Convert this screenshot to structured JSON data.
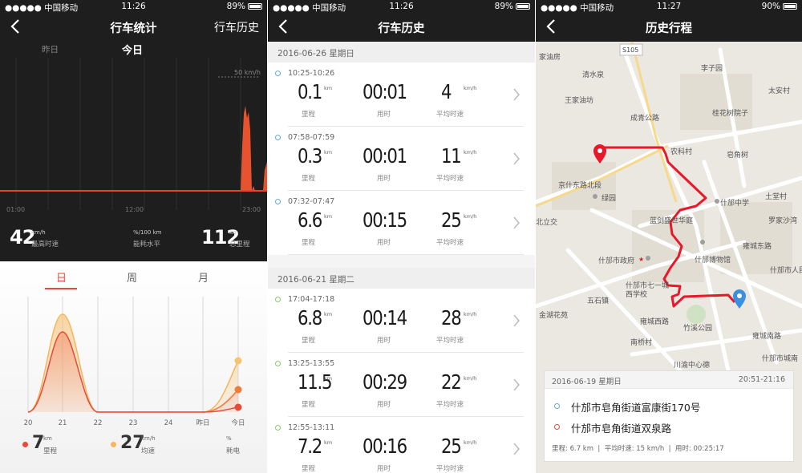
{
  "screens": [
    {
      "status": {
        "carrier": "●●●●● 中国移动",
        "wifi": "wifi-icon",
        "time": "11:26",
        "battery": "89%"
      },
      "nav": {
        "title": "行车统计",
        "right": "行车历史"
      },
      "day_tabs": {
        "yesterday": "昨日",
        "today": "今日"
      },
      "speed_chart": {
        "limit_label": "50 km/h",
        "x_ticks": [
          "01:00",
          "12:00",
          "23:00"
        ]
      },
      "stats": [
        {
          "value": "42",
          "unit": "km/h",
          "label": "最高时速"
        },
        {
          "value": "",
          "unit": "%/100 km",
          "label": "能耗水平"
        },
        {
          "value": "112",
          "unit": "km",
          "label": "总里程"
        }
      ],
      "period_tabs": [
        "日",
        "周",
        "月"
      ],
      "trend_chart": {
        "x_ticks": [
          "20",
          "21",
          "22",
          "23",
          "24",
          "昨日",
          "今日"
        ],
        "colors": {
          "mileage": "#e64a3a",
          "speed": "#f6b65a",
          "battery": "#f07c3b"
        }
      },
      "legend": [
        {
          "value": "7",
          "unit": "km",
          "label": "里程",
          "color": "#e64a3a"
        },
        {
          "value": "27",
          "unit": "km/h",
          "label": "均速",
          "color": "#f6b65a"
        },
        {
          "value": "",
          "unit": "%",
          "label": "耗电",
          "color": ""
        }
      ]
    },
    {
      "status": {
        "carrier": "●●●●● 中国移动",
        "time": "11:26",
        "battery": "89%"
      },
      "nav": {
        "title": "行车历史"
      },
      "groups": [
        {
          "date": "2016-06-26 星期日",
          "trips": [
            {
              "time": "10:25-10:26",
              "distance": "0.1",
              "dist_unit": "km",
              "dist_label": "里程",
              "duration": "00:01",
              "dur_label": "用时",
              "speed": "4",
              "speed_unit": "km/h",
              "speed_label": "平均时速"
            },
            {
              "time": "07:58-07:59",
              "distance": "0.3",
              "dist_unit": "km",
              "dist_label": "里程",
              "duration": "00:01",
              "dur_label": "用时",
              "speed": "11",
              "speed_unit": "km/h",
              "speed_label": "平均时速"
            },
            {
              "time": "07:32-07:47",
              "distance": "6.6",
              "dist_unit": "km",
              "dist_label": "里程",
              "duration": "00:15",
              "dur_label": "用时",
              "speed": "25",
              "speed_unit": "km/h",
              "speed_label": "平均时速"
            }
          ]
        },
        {
          "date": "2016-06-21 星期二",
          "trips": [
            {
              "time": "17:04-17:18",
              "distance": "6.8",
              "dist_unit": "km",
              "dist_label": "里程",
              "duration": "00:14",
              "dur_label": "用时",
              "speed": "28",
              "speed_unit": "km/h",
              "speed_label": "平均时速"
            },
            {
              "time": "13:25-13:55",
              "distance": "11.5",
              "dist_unit": "km",
              "dist_label": "里程",
              "duration": "00:29",
              "dur_label": "用时",
              "speed": "22",
              "speed_unit": "km/h",
              "speed_label": "平均时速"
            },
            {
              "time": "12:55-13:11",
              "distance": "7.2",
              "dist_unit": "km",
              "dist_label": "里程",
              "duration": "00:16",
              "dur_label": "用时",
              "speed": "25",
              "speed_unit": "km/h",
              "speed_label": "平均时速"
            }
          ]
        }
      ]
    },
    {
      "status": {
        "carrier": "●●●●● 中国移动",
        "time": "11:27",
        "battery": "90%"
      },
      "nav": {
        "title": "历史行程"
      },
      "map_labels": [
        "家油房",
        "S105",
        "李子园",
        "清水泉",
        "王家油坊",
        "太安村",
        "桂花树院子",
        "皂角树",
        "农科村",
        "成青公路",
        "京什东路北段",
        "什邡中学",
        "土堂村",
        "绿园",
        "蓝剑盛世华庭",
        "罗家沙湾",
        "北立交",
        "什邡博物馆",
        "什邡市政府",
        "什邡市人民",
        "五石镇",
        "什邡市七一城西学校",
        "雍城东路",
        "金湖花苑",
        "竹溪公园",
        "南桥村",
        "什邡市城南",
        "川渝中心德",
        "雍城南路",
        "雍城西路"
      ],
      "trip": {
        "date": "2016-06-19 星期日",
        "time_range": "20:51-21:16",
        "start": "什邡市皂角街道富康街170号",
        "end": "什邡市皂角街道双泉路",
        "mileage_label": "里程:",
        "mileage": "6.7 km",
        "speed_label": "平均时速:",
        "speed": "15 km/h",
        "duration_label": "用时:",
        "duration": "00:25:17"
      }
    }
  ]
}
